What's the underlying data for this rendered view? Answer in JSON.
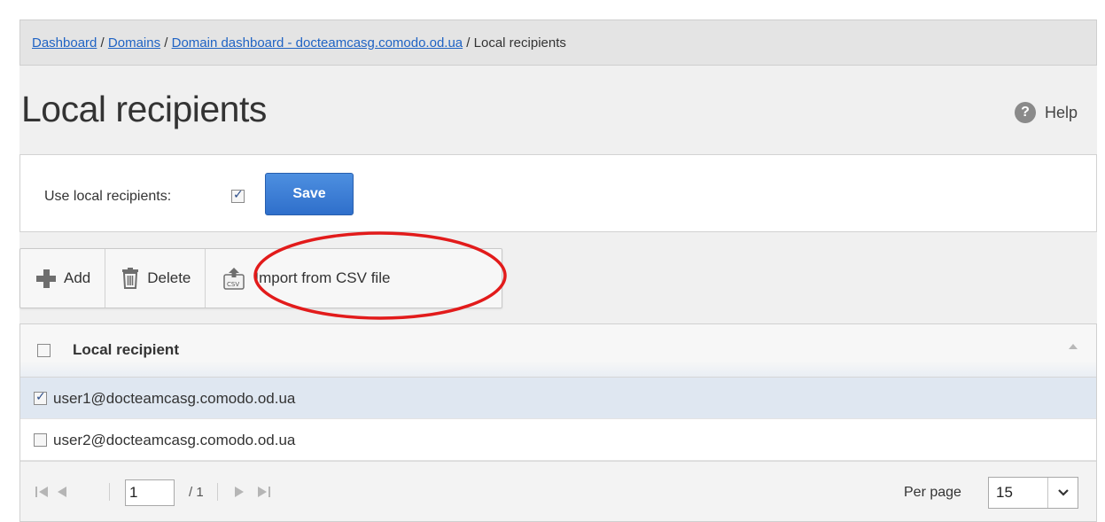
{
  "breadcrumb": {
    "items": [
      {
        "label": "Dashboard",
        "link": true
      },
      {
        "label": "Domains",
        "link": true
      },
      {
        "label": "Domain dashboard - docteamcasg.comodo.od.ua",
        "link": true
      },
      {
        "label": "Local recipients",
        "link": false
      }
    ],
    "separator": " / "
  },
  "page_title": "Local recipients",
  "help_label": "Help",
  "settings": {
    "use_local_label": "Use local recipients:",
    "use_local_checked": true,
    "save_label": "Save"
  },
  "toolbar": {
    "add_label": "Add",
    "delete_label": "Delete",
    "import_label": "Import from CSV file",
    "highlight_color": "#e21b1b"
  },
  "grid": {
    "column_header": "Local recipient",
    "rows": [
      {
        "email": "user1@docteamcasg.comodo.od.ua",
        "checked": true
      },
      {
        "email": "user2@docteamcasg.comodo.od.ua",
        "checked": false
      }
    ]
  },
  "pager": {
    "current_page": "1",
    "total_pages": "/ 1",
    "per_page_label": "Per page",
    "per_page_value": "15"
  },
  "colors": {
    "accent": "#2f6fcb",
    "link": "#1f63c4",
    "selected_row": "#dfe7f1"
  }
}
